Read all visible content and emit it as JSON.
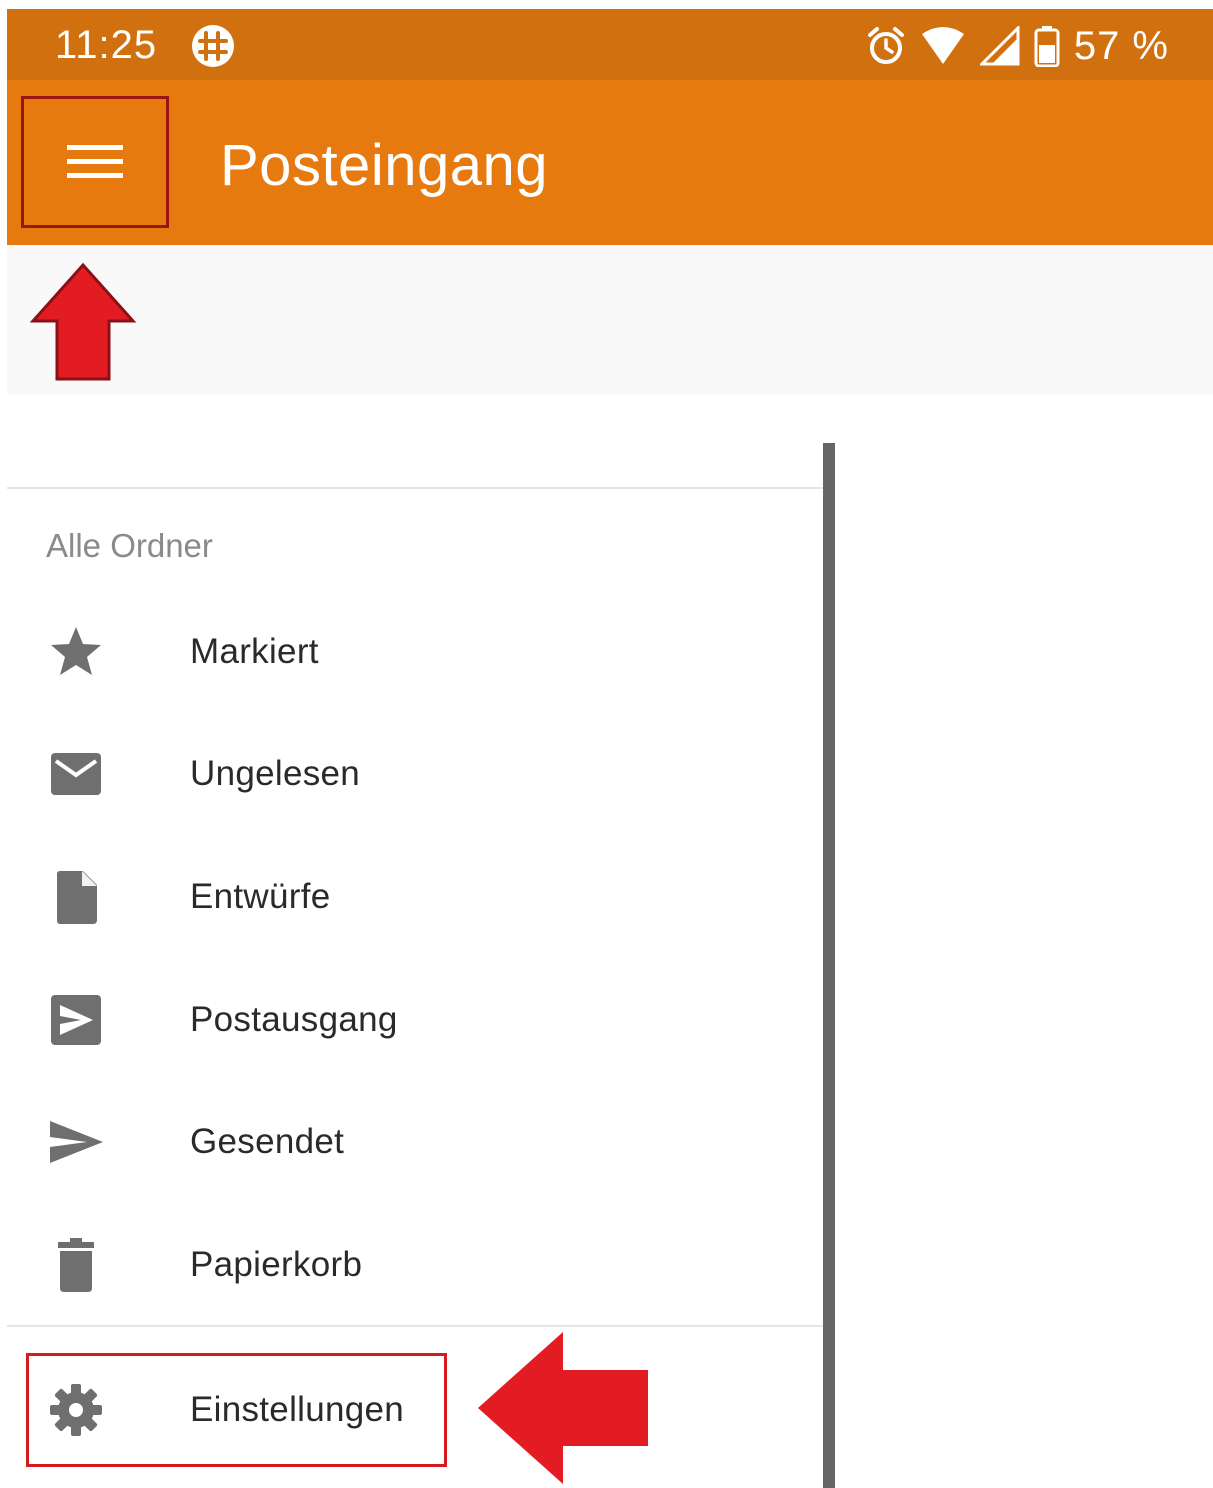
{
  "status_bar": {
    "time": "11:25",
    "battery": "57 %",
    "icons": [
      "app-notification-icon",
      "alarm-icon",
      "wifi-icon",
      "signal-icon",
      "battery-icon"
    ]
  },
  "app_bar": {
    "title": "Posteingang",
    "menu_icon": "hamburger-menu-icon",
    "color": "#e77a0f",
    "status_color": "#d1700f"
  },
  "drawer": {
    "section_label": "Alle Ordner",
    "items": [
      {
        "label": "Markiert",
        "icon": "star-icon"
      },
      {
        "label": "Ungelesen",
        "icon": "envelope-icon"
      },
      {
        "label": "Entwürfe",
        "icon": "draft-icon"
      },
      {
        "label": "Postausgang",
        "icon": "outbox-icon"
      },
      {
        "label": "Gesendet",
        "icon": "send-icon"
      },
      {
        "label": "Papierkorb",
        "icon": "trash-icon"
      }
    ],
    "settings": {
      "label": "Einstellungen",
      "icon": "gear-icon"
    }
  },
  "annotations": {
    "highlight_color": "#d71920",
    "arrows": [
      "arrow-up-icon",
      "arrow-left-icon"
    ]
  }
}
